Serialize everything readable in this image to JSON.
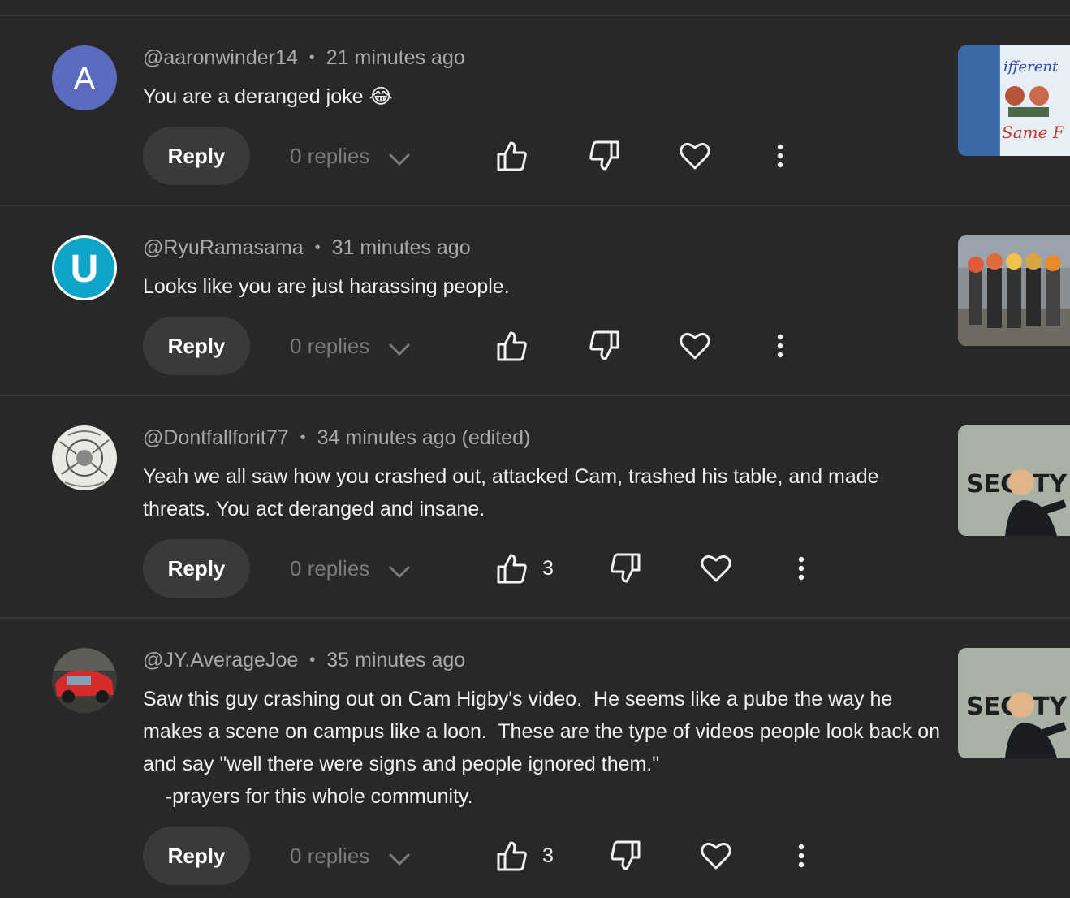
{
  "labels": {
    "reply": "Reply",
    "replies": "0 replies"
  },
  "comments": [
    {
      "author": "@aaronwinder14",
      "time": "21 minutes ago",
      "text": "You are a deranged joke 😂",
      "likes": "",
      "avatar": {
        "type": "letter",
        "letter": "A",
        "color": "#5c6bc0"
      }
    },
    {
      "author": "@RyuRamasama",
      "time": "31 minutes ago",
      "text": "Looks like you are just harassing people.",
      "likes": "",
      "avatar": {
        "type": "letter",
        "letter": "U",
        "color": "#0ea5c9"
      }
    },
    {
      "author": "@Dontfallforit77",
      "time": "34 minutes ago (edited)",
      "text": "Yeah we all saw how you crashed out, attacked Cam, trashed his table, and made threats. You act deranged and insane.",
      "likes": "3",
      "avatar": {
        "type": "image",
        "description": "sketch-drawing"
      }
    },
    {
      "author": "@JY.AverageJoe",
      "time": "35 minutes ago",
      "text": "Saw this guy crashing out on Cam Higby's video.  He seems like a pube the way he makes a scene on campus like a loon.  These are the type of videos people look back on and say \"well there were signs and people ignored them.\"\n    -prayers for this whole community.",
      "likes": "3",
      "avatar": {
        "type": "image",
        "description": "red-car"
      }
    }
  ],
  "thumbnails": [
    {
      "caption_top": "ifferent",
      "caption_bottom": "Same F"
    },
    {
      "caption_top": "",
      "caption_bottom": ""
    },
    {
      "caption_top": "SEC",
      "caption_bottom": "TY T"
    },
    {
      "caption_top": "SEC",
      "caption_bottom": "TY T"
    }
  ],
  "icons": [
    "like-icon",
    "dislike-icon",
    "heart-icon",
    "more-icon",
    "chevron-down-icon"
  ],
  "colors": {
    "background": "#282828",
    "divider": "#3a3a3a",
    "button_bg": "#3a3a3a",
    "meta_text": "#aaaaaa",
    "muted_text": "#7a7a7a"
  }
}
